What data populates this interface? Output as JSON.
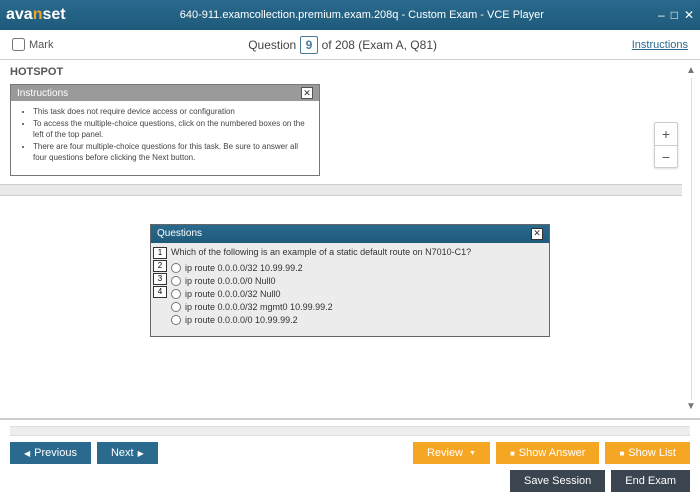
{
  "titlebar": {
    "logo_pre": "ava",
    "logo_n": "n",
    "logo_post": "set",
    "title": "640-911.examcollection.premium.exam.208q - Custom Exam - VCE Player"
  },
  "qheader": {
    "mark_label": "Mark",
    "question_word": "Question",
    "current": "9",
    "of_text": " of 208 (Exam A, Q81)",
    "instructions_link": "Instructions"
  },
  "hotspot_label": "HOTSPOT",
  "zoom": {
    "plus": "+",
    "minus": "−"
  },
  "instructions_box": {
    "title": "Instructions",
    "items": [
      "This task does not require device access or configuration",
      "To access the multiple-choice questions, click on the numbered boxes on the left of the top panel.",
      "There are four multiple-choice questions for this task. Be sure to answer all four questions before clicking the Next button."
    ],
    "bold_word": "Next"
  },
  "qpanel": {
    "title": "Questions",
    "numbers": [
      "1",
      "2",
      "3",
      "4"
    ],
    "question_text": "Which of the following is an example of a static default route on N7010-C1?",
    "options": [
      "ip route 0.0.0.0/32 10.99.99.2",
      "ip route 0.0.0.0/0 Null0",
      "ip route 0.0.0.0/32 Null0",
      "ip route 0.0.0.0/32 mgmt0 10.99.99.2",
      "ip route 0.0.0.0/0 10.99.99.2"
    ]
  },
  "footer": {
    "previous": "Previous",
    "next": "Next",
    "review": "Review",
    "show_answer": "Show Answer",
    "show_list": "Show List",
    "save_session": "Save Session",
    "end_exam": "End Exam"
  }
}
